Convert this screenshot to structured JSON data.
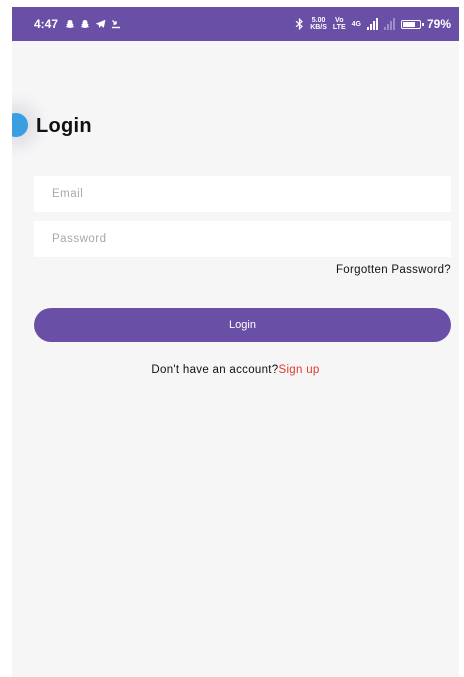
{
  "status_bar": {
    "time": "4:47",
    "left_icons": [
      "snapchat-icon",
      "snapchat-icon",
      "telegram-icon",
      "download-icon"
    ],
    "speed_top": "5.00",
    "speed_bottom": "KB/S",
    "volte_top": "Vo",
    "volte_bottom": "LTE",
    "network_label": "4G",
    "battery_percent": "79%",
    "battery_level": 0.79
  },
  "login": {
    "title": "Login",
    "email_placeholder": "Email",
    "email_value": "",
    "password_placeholder": "Password",
    "password_value": "",
    "forgot_label": "Forgotten Password?",
    "button_label": "Login",
    "no_account_text": "Don't have an account?",
    "signup_label": "Sign up"
  },
  "colors": {
    "primary": "#6a4fa6",
    "link": "#e03a2e",
    "background": "#f6f6f7",
    "field_background": "#ffffff",
    "side_handle": "#3b9ee0"
  }
}
